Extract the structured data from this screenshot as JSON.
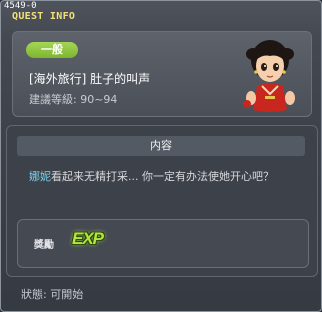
{
  "window": {
    "id": "4549-0",
    "title": "QUEST INFO"
  },
  "quest": {
    "category": "一般",
    "name": "[海外旅行] 肚子的叫声",
    "level": "建議等級: 90~94"
  },
  "content": {
    "heading": "内容",
    "npc_name": "娜妮",
    "text": "看起来无精打采... 你一定有办法使她开心吧？"
  },
  "reward": {
    "label": "獎勵",
    "icon": "exp-icon",
    "icon_text": "EXP"
  },
  "status": "狀態: 可開始"
}
